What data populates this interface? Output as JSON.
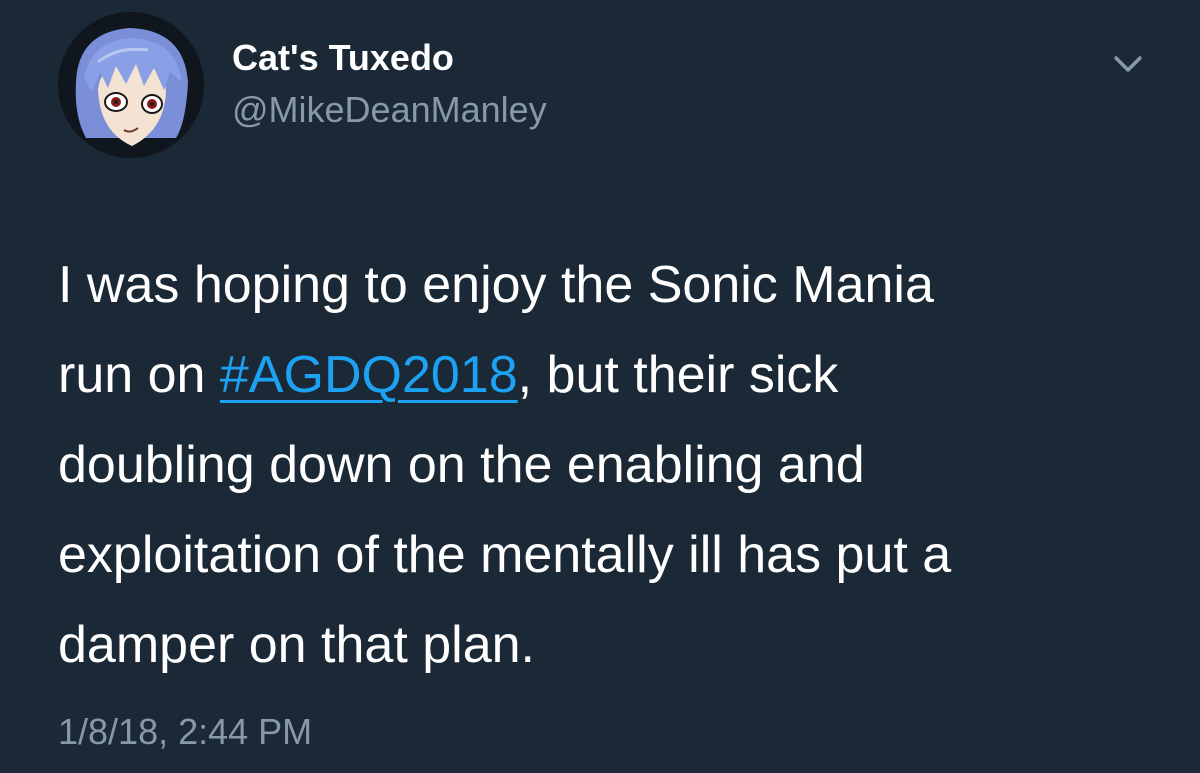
{
  "tweet": {
    "author": {
      "display_name": "Cat's Tuxedo",
      "handle": "@MikeDeanManley"
    },
    "text_line_1": "I was hoping to enjoy the Sonic Mania",
    "text_line_2_before": "run on ",
    "hashtag": "#AGDQ2018",
    "text_line_2_after": ", but their sick",
    "text_line_3": "doubling down on the enabling and",
    "text_line_4": "exploitation of the mentally ill has put a",
    "text_line_5": "damper on that plan.",
    "timestamp": "1/8/18, 2:44 PM"
  },
  "colors": {
    "background": "#1b2836",
    "text_primary": "#ffffff",
    "text_secondary": "#8899a6",
    "link": "#1da1f2"
  },
  "icons": {
    "menu": "chevron-down-icon",
    "avatar": "anime-character-avatar"
  }
}
